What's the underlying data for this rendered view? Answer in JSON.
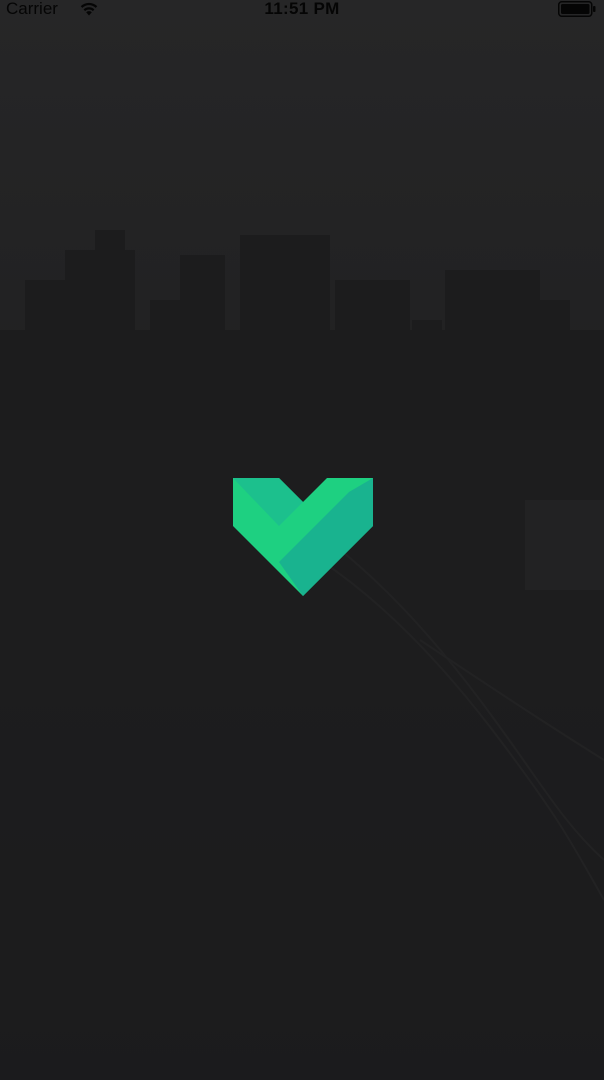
{
  "status_bar": {
    "carrier": "Carrier",
    "time": "11:51 PM",
    "wifi_icon": "wifi-icon",
    "battery_icon": "battery-icon"
  },
  "splash": {
    "logo_icon": "heart-chevron-logo-icon"
  },
  "colors": {
    "background": "#1d1d1e",
    "logo_light": "#1ed081",
    "logo_mid": "#1cc08d",
    "logo_dark": "#19b38f",
    "status_text": "#050505"
  }
}
